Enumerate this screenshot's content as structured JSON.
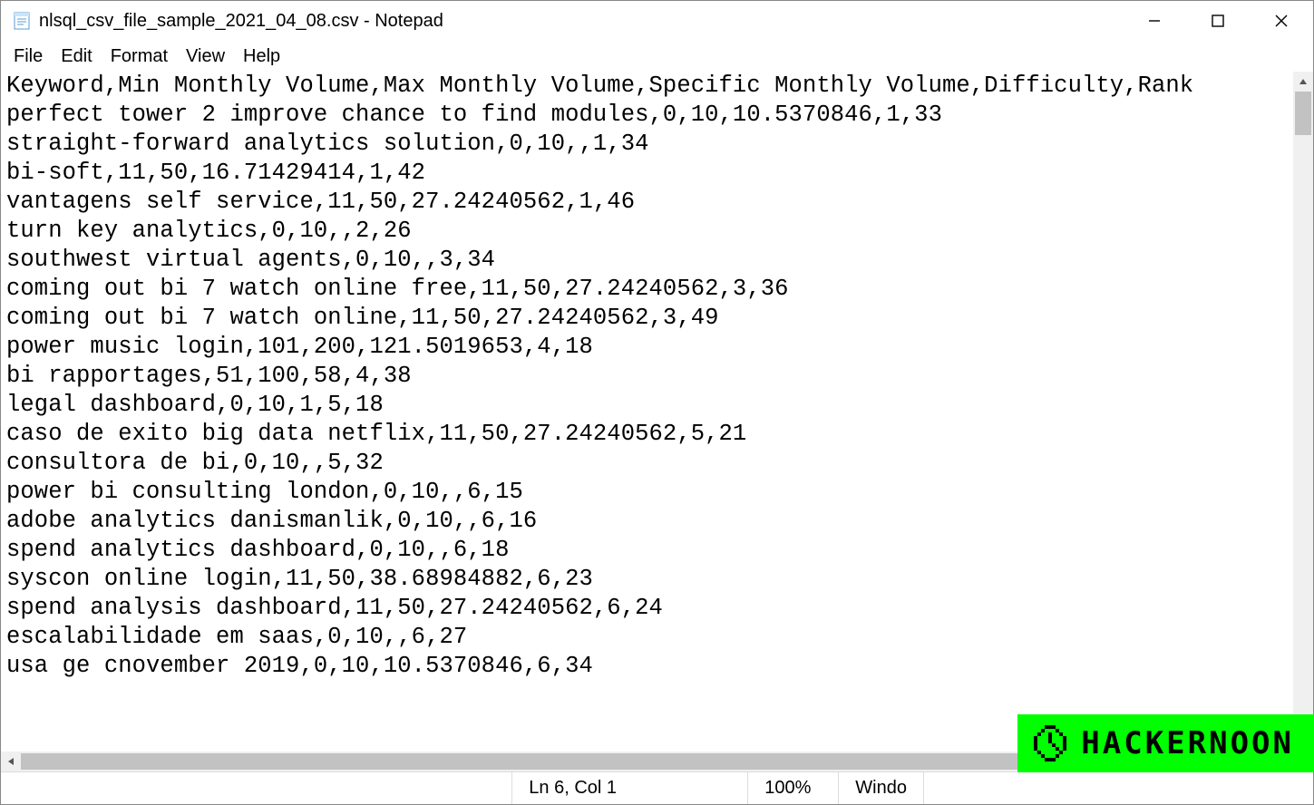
{
  "titlebar": {
    "title": "nlsql_csv_file_sample_2021_04_08.csv - Notepad"
  },
  "menu": {
    "file": "File",
    "edit": "Edit",
    "format": "Format",
    "view": "View",
    "help": "Help"
  },
  "content_lines": [
    "Keyword,Min Monthly Volume,Max Monthly Volume,Specific Monthly Volume,Difficulty,Rank",
    "perfect tower 2 improve chance to find modules,0,10,10.5370846,1,33",
    "straight-forward analytics solution,0,10,,1,34",
    "bi-soft,11,50,16.71429414,1,42",
    "vantagens self service,11,50,27.24240562,1,46",
    "turn key analytics,0,10,,2,26",
    "southwest virtual agents,0,10,,3,34",
    "coming out bi 7 watch online free,11,50,27.24240562,3,36",
    "coming out bi 7 watch online,11,50,27.24240562,3,49",
    "power music login,101,200,121.5019653,4,18",
    "bi rapportages,51,100,58,4,38",
    "legal dashboard,0,10,1,5,18",
    "caso de exito big data netflix,11,50,27.24240562,5,21",
    "consultora de bi,0,10,,5,32",
    "power bi consulting london,0,10,,6,15",
    "adobe analytics danismanlik,0,10,,6,16",
    "spend analytics dashboard,0,10,,6,18",
    "syscon online login,11,50,38.68984882,6,23",
    "spend analysis dashboard,11,50,27.24240562,6,24",
    "escalabilidade em saas,0,10,,6,27",
    "usa ge cnovember 2019,0,10,10.5370846,6,34"
  ],
  "statusbar": {
    "position": "Ln 6, Col 1",
    "zoom": "100%",
    "line_ending": "Windo"
  },
  "watermark": {
    "text": "HACKERNOON"
  }
}
